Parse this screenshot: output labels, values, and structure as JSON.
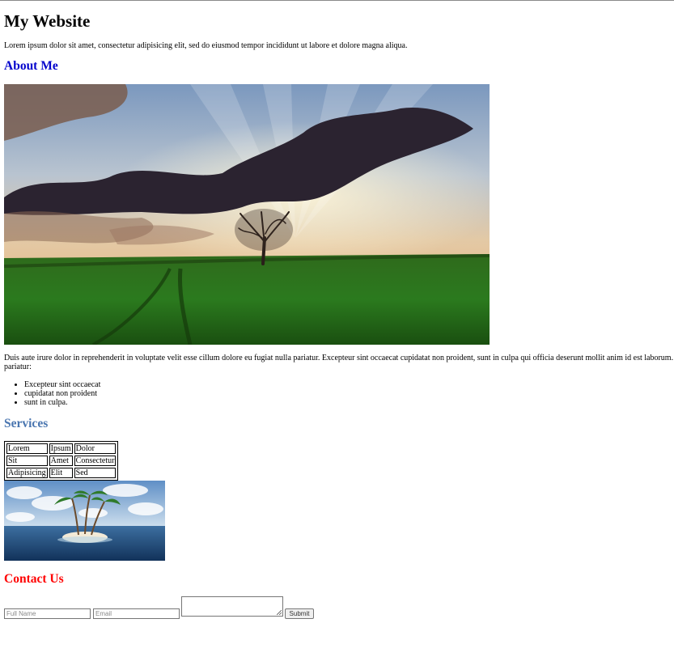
{
  "page": {
    "title": "My Website",
    "intro": "Lorem ipsum dolor sit amet, consectetur adipisicing elit, sed do eiusmod tempor incididunt ut labore et dolore magna aliqua."
  },
  "about": {
    "heading": "About Me",
    "heading_color": "#0000cc",
    "image_icon": "landscape-tree-sunrays",
    "paragraph": "Duis aute irure dolor in reprehenderit in voluptate velit esse cillum dolore eu fugiat nulla pariatur. Excepteur sint occaecat cupidatat non proident, sunt in culpa qui officia deserunt mollit anim id est laborum. pariatur:",
    "list": [
      "Excepteur sint occaecat",
      "cupidatat non proident",
      "sunt in culpa."
    ]
  },
  "services": {
    "heading": "Services",
    "heading_color": "#4a76b0",
    "table": [
      [
        "Lorem",
        "Ipsum",
        "Dolor"
      ],
      [
        "Sit",
        "Amet",
        "Consectetur"
      ],
      [
        "Adipisicing",
        "Elit",
        "Sed"
      ]
    ],
    "image_icon": "tropical-island-palms"
  },
  "contact": {
    "heading": "Contact Us",
    "heading_color": "#ff0000",
    "name_placeholder": "Full Name",
    "email_placeholder": "Email",
    "submit_label": "Submit"
  }
}
